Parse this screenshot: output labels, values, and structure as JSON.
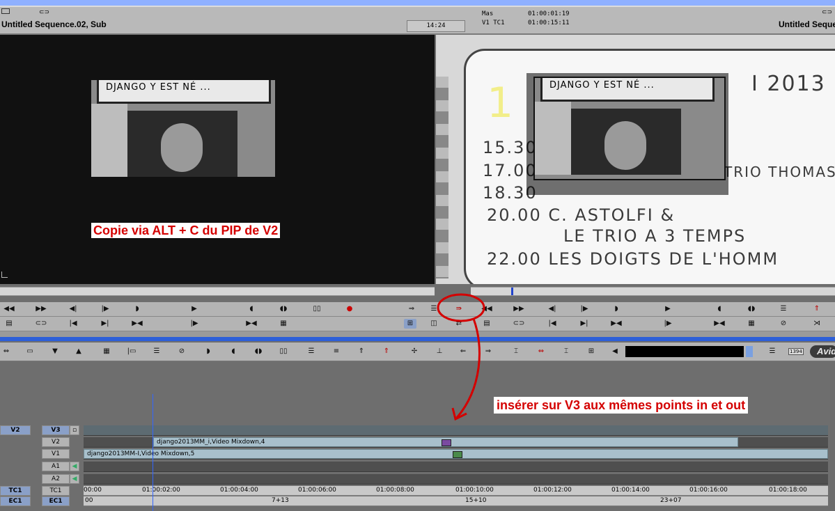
{
  "header": {
    "left_title": "Untitled Sequence.02, Sub",
    "right_title": "Untitled Seque",
    "center_tc": "14:24",
    "mas_label": "Mas",
    "mas_value": "01:00:01:19",
    "v1tc_label": "V1 TC1",
    "v1tc_value": "01:00:15:11"
  },
  "source_monitor": {
    "frame_sign_text": "DJANGO Y EST NÉ ...",
    "caption": "Copie via ALT + C du PIP de V2"
  },
  "record_monitor": {
    "poster_lines": [
      "1",
      "I 2013",
      "15.30",
      "17.00",
      "18.30",
      "20.00 C. ASTOLFI &",
      "LE TRIO A 3 TEMPS",
      "22.00 LES DOIGTS DE L'HOMM",
      "TRIO THOMAS BAGGERM"
    ],
    "pip_sign_text": "DJANGO Y EST NÉ ..."
  },
  "annotation": {
    "insert_note": "insérer sur V3 aux mêmes points in et out"
  },
  "tracks": {
    "rows": [
      {
        "src": "V2",
        "rec": "V3"
      },
      {
        "src": "",
        "rec": "V2"
      },
      {
        "src": "",
        "rec": "V1"
      },
      {
        "src": "",
        "rec": "A1"
      },
      {
        "src": "",
        "rec": "A2"
      },
      {
        "src": "TC1",
        "rec": "TC1"
      },
      {
        "src": "EC1",
        "rec": "EC1"
      }
    ],
    "clip_v2": "django2013MM_i,Video Mixdown,4",
    "clip_v1": "django2013MM-I,Video Mixdown,5"
  },
  "timecode_ruler": [
    "00:00",
    "01:00:02:00",
    "01:00:04:00",
    "01:00:06:00",
    "01:00:08:00",
    "01:00:10:00",
    "01:00:12:00",
    "01:00:14:00",
    "01:00:16:00",
    "01:00:18:00"
  ],
  "edgecode_ruler": [
    "00",
    "7+13",
    "15+10",
    "23+07"
  ],
  "toolbar": {
    "logo": "Avid",
    "format_label": "1394"
  },
  "colors": {
    "annotation_red": "#d40000",
    "separator_blue": "#2d5fd8",
    "clip_fill": "#a8c0cc"
  }
}
